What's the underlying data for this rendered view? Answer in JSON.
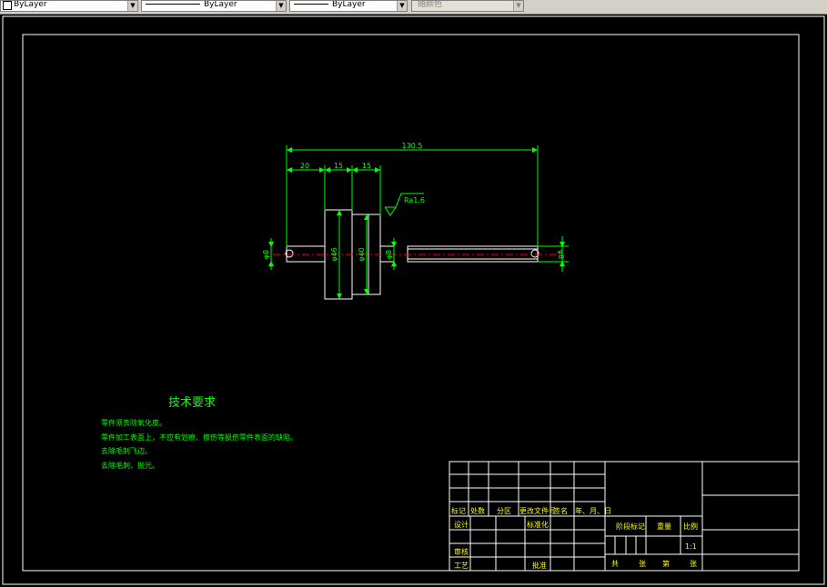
{
  "toolbar": {
    "color_value": "ByLayer",
    "linetype_value": "ByLayer",
    "lineweight_value": "ByLayer",
    "plotstyle_value": "随颜色"
  },
  "drawing": {
    "dimensions": {
      "overall_length": "130.5",
      "d1": "20",
      "d2": "15",
      "d3": "15",
      "roughness": "Ra1.6",
      "dia_left": "φ8",
      "dia_body1": "φ46",
      "dia_body2": "φ40",
      "dia_neck": "φ8",
      "dia_right": "φ8"
    },
    "tech_req": {
      "title": "技术要求",
      "lines": [
        "零件须去除氧化皮。",
        "零件加工表面上，不应有划痕、擦伤等损伤零件表面的缺陷。",
        "去除毛刺飞边。",
        "去除毛刺，抛光。"
      ]
    },
    "title_block": {
      "mark": "标记",
      "count": "处数",
      "zone": "分区",
      "change_doc": "更改文件号",
      "sign": "签名",
      "date": "年、月、日",
      "design": "设计",
      "standardize": "标准化",
      "review": "审核",
      "process": "工艺",
      "approve": "批准",
      "stage_mark": "阶段标记",
      "weight": "重量",
      "scale": "比例",
      "scale_value": "1:1",
      "total": "共",
      "sheet1": "张",
      "page": "第",
      "sheet2": "张"
    }
  },
  "colors": {
    "background": "#000000",
    "frame": "#ffffff",
    "dimension": "#00ff00",
    "centerline": "#ff0000",
    "tech_text": "#00ff00",
    "title_text": "#ffff00"
  }
}
